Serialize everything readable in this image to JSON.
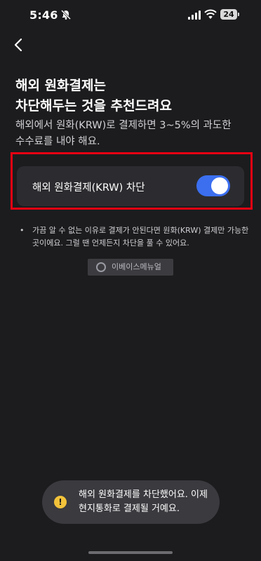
{
  "status_bar": {
    "time": "5:46",
    "battery": "24"
  },
  "title": {
    "line1": "해외 원화결제는",
    "line2": "차단해두는 것을 추천드려요"
  },
  "description": {
    "line1": "해외에서 원화(KRW)로 결제하면 3~5%의 과도한",
    "line2": "수수료를 내야 해요."
  },
  "setting": {
    "label": "해외 원화결제(KRW) 차단",
    "enabled": true
  },
  "note": {
    "bullet": "•",
    "line1": "가끔 알 수 없는 이유로 결제가 안된다면 원화(KRW) 결제만 가능한",
    "line2": "곳이에요. 그럴 땐 언제든지 차단을 풀 수 있어요."
  },
  "watermark": "이베이스메뉴얼",
  "toast": {
    "icon": "!",
    "line1": "해외 원화결제를 차단했어요. 이제",
    "line2": "현지통화로 결제될 거예요."
  },
  "colors": {
    "background": "#1c1c1e",
    "toggle_on": "#3b6ff0",
    "highlight": "#e60012",
    "warning": "#f2c23a"
  },
  "icons": [
    "silent-bell-icon",
    "cellular-signal-icon",
    "wifi-icon",
    "battery-icon",
    "back-arrow-icon",
    "warning-icon",
    "watermark-logo-icon"
  ]
}
